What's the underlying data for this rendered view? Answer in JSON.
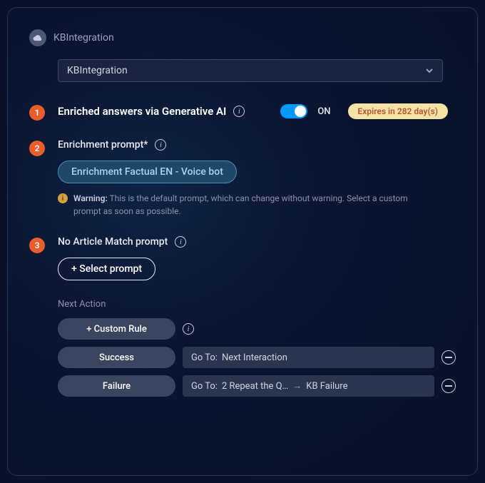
{
  "title": "KBIntegration",
  "select": {
    "value": "KBIntegration"
  },
  "sections": {
    "enriched": {
      "step": "1",
      "heading": "Enriched answers via Generative AI",
      "toggle_state": "ON",
      "expires": "Expires in 282 day(s)"
    },
    "enrichment": {
      "step": "2",
      "heading": "Enrichment prompt*",
      "button": "Enrichment Factual EN - Voice bot",
      "warning_label": "Warning:",
      "warning_text": "This is the default prompt, which can change without warning. Select a custom prompt as soon as possible."
    },
    "nomatch": {
      "step": "3",
      "heading": "No Article Match prompt",
      "button": "+ Select prompt"
    }
  },
  "next_action": {
    "title": "Next Action",
    "custom_rule": "+ Custom Rule",
    "rows": [
      {
        "label": "Success",
        "prefix": "Go To:",
        "value": "Next Interaction",
        "chain": ""
      },
      {
        "label": "Failure",
        "prefix": "Go To:",
        "value": "2 Repeat the Q…",
        "chain": "KB Failure"
      }
    ]
  }
}
